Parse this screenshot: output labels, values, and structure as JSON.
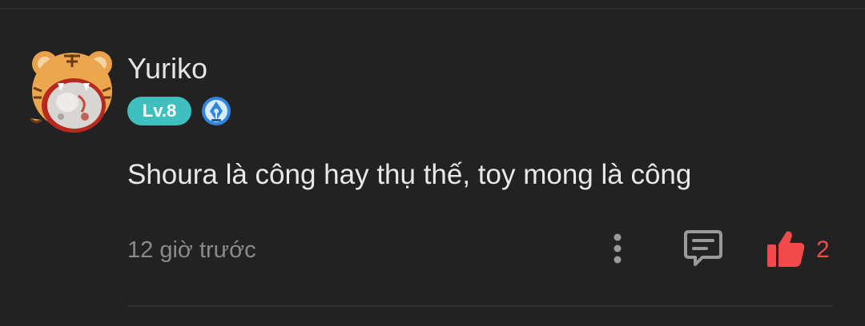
{
  "comment": {
    "username": "Yuriko",
    "level": "Lv.8",
    "text": "Shoura là công hay thụ thế, toy mong là công",
    "timestamp": "12 giờ trước",
    "like_count": "2",
    "liked": true
  },
  "icons": {
    "avatar": "tiger-avatar-icon",
    "creator_badge": "pen-nib-badge-icon",
    "more": "more-vertical-icon",
    "reply": "comment-bubble-icon",
    "like": "thumbs-up-icon"
  },
  "colors": {
    "background": "#222222",
    "level_badge": "#3fbfbe",
    "like_active": "#f04a4a",
    "muted_text": "#8a8a8a",
    "icon_gray": "#9a9a9a"
  }
}
